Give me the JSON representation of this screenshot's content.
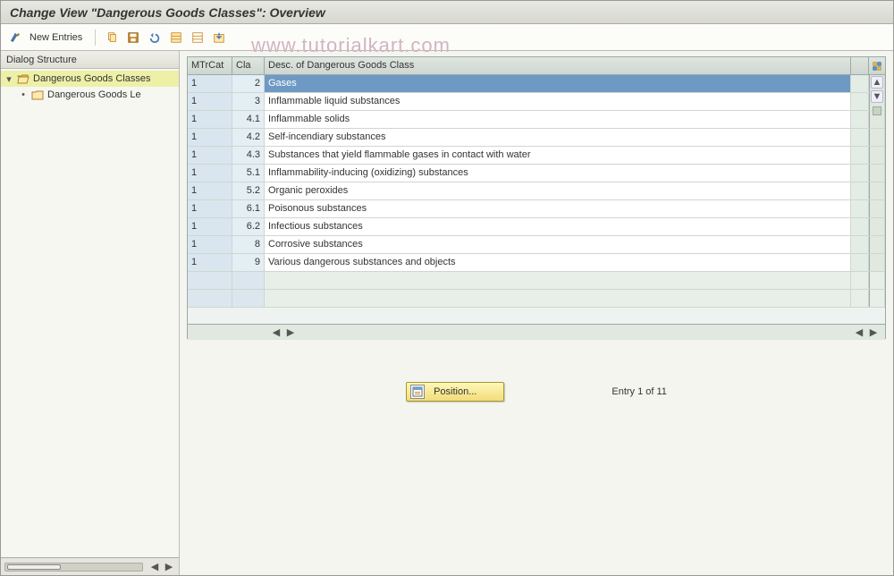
{
  "title": "Change View \"Dangerous Goods Classes\": Overview",
  "toolbar": {
    "new_entries": "New Entries"
  },
  "watermark": "www.tutorialkart.com",
  "sidebar": {
    "header": "Dialog Structure",
    "items": [
      {
        "label": "Dangerous Goods Classes",
        "open": true,
        "selected": true,
        "level": 0
      },
      {
        "label": "Dangerous Goods Le",
        "open": false,
        "selected": false,
        "level": 1
      }
    ]
  },
  "grid": {
    "columns": {
      "c1": "MTrCat",
      "c2": "Cla",
      "c3": "Desc. of Dangerous Goods Class"
    },
    "rows": [
      {
        "mtrcat": "1",
        "cla": "2",
        "desc": "Gases",
        "selected": true
      },
      {
        "mtrcat": "1",
        "cla": "3",
        "desc": "Inflammable liquid substances"
      },
      {
        "mtrcat": "1",
        "cla": "4.1",
        "desc": "Inflammable solids"
      },
      {
        "mtrcat": "1",
        "cla": "4.2",
        "desc": "Self-incendiary substances"
      },
      {
        "mtrcat": "1",
        "cla": "4.3",
        "desc": "Substances that yield flammable gases in contact with water"
      },
      {
        "mtrcat": "1",
        "cla": "5.1",
        "desc": "Inflammability-inducing (oxidizing) substances"
      },
      {
        "mtrcat": "1",
        "cla": "5.2",
        "desc": "Organic peroxides"
      },
      {
        "mtrcat": "1",
        "cla": "6.1",
        "desc": "Poisonous substances"
      },
      {
        "mtrcat": "1",
        "cla": "6.2",
        "desc": "Infectious substances"
      },
      {
        "mtrcat": "1",
        "cla": "8",
        "desc": "Corrosive substances"
      },
      {
        "mtrcat": "1",
        "cla": "9",
        "desc": "Various dangerous substances and objects"
      }
    ]
  },
  "footer": {
    "position_label": "Position...",
    "entry_text": "Entry 1 of 11"
  }
}
